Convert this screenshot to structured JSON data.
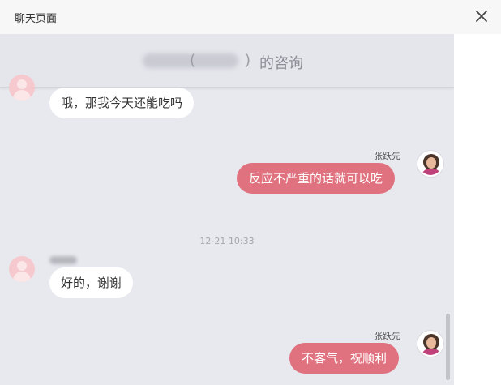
{
  "window": {
    "title": "聊天页面"
  },
  "header": {
    "patient_name": "",
    "age": "",
    "paren_open": "(",
    "paren_close": ")",
    "suffix": "的咨询"
  },
  "messages": [
    {
      "side": "left",
      "text": "哦，那我今天还能吃吗"
    },
    {
      "side": "right",
      "sender": "张跃先",
      "text": "反应不严重的话就可以吃"
    },
    {
      "side": "left",
      "text": "好的，谢谢"
    },
    {
      "side": "right",
      "sender": "张跃先",
      "text": "不客气，祝顺利"
    }
  ],
  "timestamp": "12-21 10:33",
  "colors": {
    "outgoing_bubble": "#e0727f",
    "incoming_bubble": "#ffffff",
    "chat_background": "#e8e9ef"
  }
}
